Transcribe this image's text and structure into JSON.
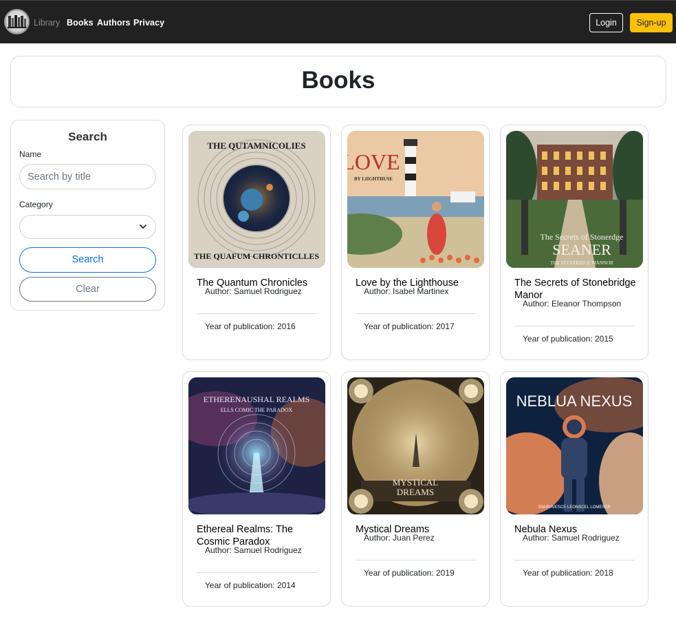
{
  "navbar": {
    "brand": "Library",
    "links": [
      "Books",
      "Authors",
      "Privacy"
    ],
    "login_label": "Login",
    "signup_label": "Sign-up"
  },
  "page": {
    "title": "Books"
  },
  "search": {
    "title": "Search",
    "name_label": "Name",
    "name_placeholder": "Search by title",
    "name_value": "",
    "category_label": "Category",
    "category_value": "",
    "search_label": "Search",
    "clear_label": "Clear"
  },
  "books": [
    {
      "title": "The Quantum Chronicles",
      "author": "Author: Samuel Rodriguez",
      "year": "Year of publication: 2016",
      "cover_text": [
        "THE QUTAMNICOLIES",
        "THE QUAFUM CHRONTICLLES"
      ],
      "palette": [
        "#d9d4c7",
        "#1a2a4a",
        "#e0a040"
      ]
    },
    {
      "title": "Love by the Lighthouse",
      "author": "Author: Isabel Martinex",
      "year": "Year of publication: 2017",
      "cover_text": [
        "LOVE",
        "BY LIIGHTHUSE"
      ],
      "palette": [
        "#e8c9a6",
        "#8fb0c8",
        "#d8463c"
      ]
    },
    {
      "title": "The Secrets of Stonebridge Manor",
      "author": "Author: Eleanor Thompson",
      "year": "Year of publication: 2015",
      "cover_text": [
        "The Secrets of Stonerdge",
        "SEANER",
        "THE STEVERIDGE MANNOR"
      ],
      "palette": [
        "#3b5a3a",
        "#7a4a3a",
        "#e9c37a"
      ]
    },
    {
      "title": "Ethereal Realms: The Cosmic Paradox",
      "author": "Author: Samuel Rodriguez",
      "year": "Year of publication: 2014",
      "cover_text": [
        "ETHERENAUSHAL REALMS",
        "ELLS COMIC THE PARADOX"
      ],
      "palette": [
        "#1d2244",
        "#6a3a7a",
        "#9be8ff"
      ]
    },
    {
      "title": "Mystical Dreams",
      "author": "Author: Juan Perez",
      "year": "Year of publication: 2019",
      "cover_text": [
        "MYSTICAL",
        "DREAMS"
      ],
      "palette": [
        "#2a2418",
        "#b89a6a",
        "#e7d6a8"
      ]
    },
    {
      "title": "Nebula Nexus",
      "author": "Author: Samuel Rodriguez",
      "year": "Year of publication: 2018",
      "cover_text": [
        "NEBLUA NEXUS",
        "SNURAVESCE LEONSCEL LOMESER"
      ],
      "palette": [
        "#0e2240",
        "#d4703a",
        "#f0e4d0"
      ]
    }
  ]
}
